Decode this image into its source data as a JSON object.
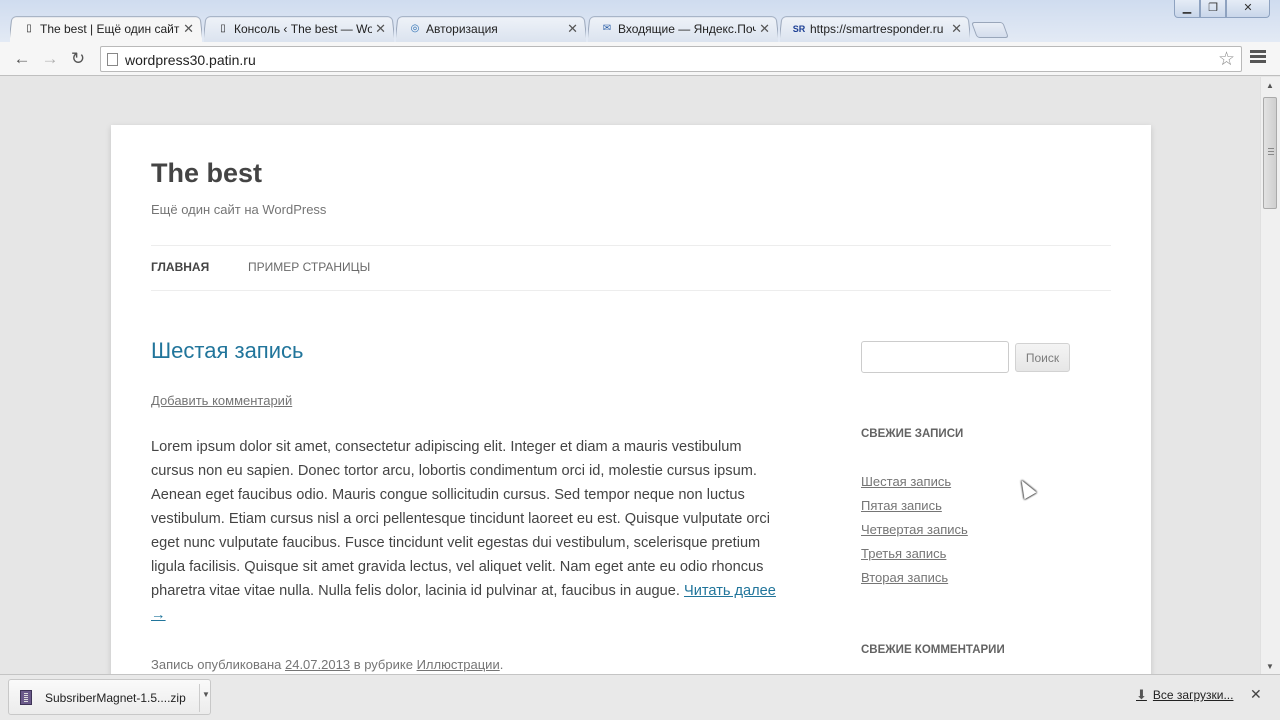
{
  "tabs": [
    {
      "title": "The best | Ещё один сайт",
      "active": true,
      "icon": "page-icon"
    },
    {
      "title": "Консоль ‹ The best — Wo",
      "active": false,
      "icon": "page-icon"
    },
    {
      "title": "Авторизация",
      "active": false,
      "icon": "globe-icon"
    },
    {
      "title": "Входящие — Яндекс.Поч",
      "active": false,
      "icon": "mail-icon"
    },
    {
      "title": "https://smartresponder.ru",
      "active": false,
      "icon": "sr-icon"
    }
  ],
  "window_buttons": {
    "minimize": "▁",
    "maximize": "❐",
    "close": "✕"
  },
  "address_bar": {
    "url": "wordpress30.patin.ru"
  },
  "site": {
    "title": "The best",
    "description": "Ещё один сайт на WordPress",
    "nav": [
      {
        "label": "Главная",
        "current": true
      },
      {
        "label": "Пример страницы",
        "current": false
      }
    ]
  },
  "post": {
    "title": "Шестая запись",
    "comment_link": "Добавить комментарий",
    "body": "Lorem ipsum dolor sit amet, consectetur adipiscing elit. Integer et diam a mauris vestibulum cursus non eu sapien. Donec tortor arcu, lobortis condimentum orci id, molestie cursus ipsum. Aenean eget faucibus odio. Mauris congue sollicitudin cursus. Sed tempor neque non luctus vestibulum. Etiam cursus nisl a orci pellentesque tincidunt laoreet eu est. Quisque vulputate orci eget nunc vulputate faucibus. Fusce tincidunt velit egestas dui vestibulum, scelerisque pretium ligula facilisis. Quisque sit amet gravida lectus, vel aliquet velit. Nam eget ante eu odio rhoncus pharetra vitae vitae nulla. Nulla felis dolor, lacinia id pulvinar at, faucibus in augue.",
    "read_more": "Читать далее →",
    "meta_prefix": "Запись опубликована",
    "date": "24.07.2013",
    "meta_middle": "в рубрике",
    "category": "Иллюстрации",
    "meta_suffix": "."
  },
  "sidebar": {
    "search_button": "Поиск",
    "recent_posts_title": "Свежие записи",
    "recent_posts": [
      "Шестая запись",
      "Пятая запись",
      "Четвертая запись",
      "Третья запись",
      "Вторая запись"
    ],
    "recent_comments_title": "Свежие комментарии"
  },
  "downloads": {
    "file_name": "SubsriberMagnet-1.5....zip",
    "all_downloads": "Все загрузки..."
  },
  "colors": {
    "link": "#21759b",
    "page_bg": "#e6e6e6"
  }
}
